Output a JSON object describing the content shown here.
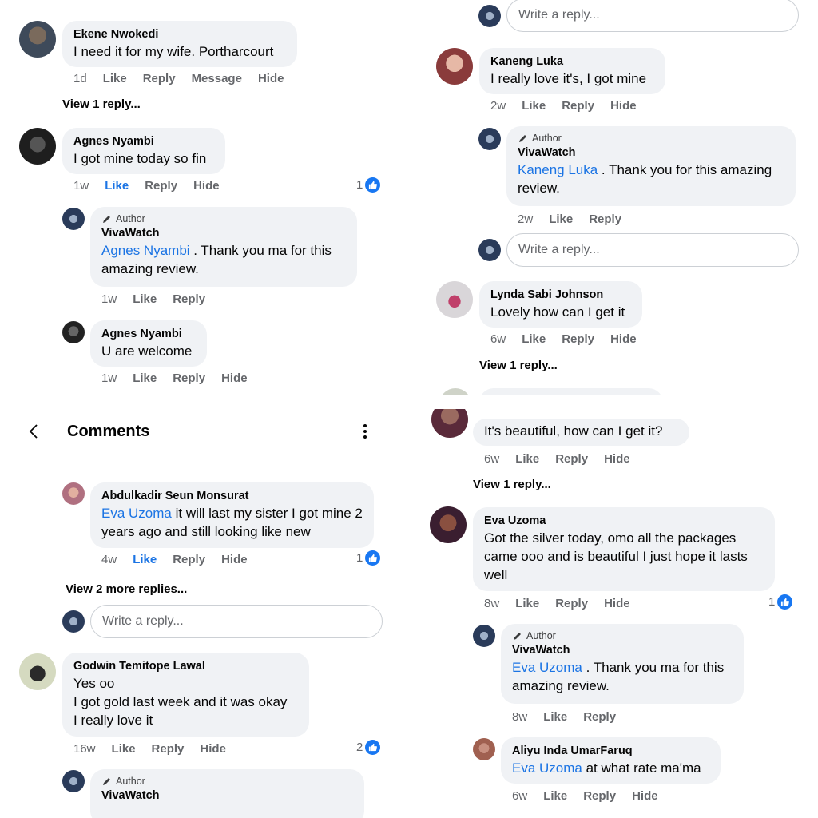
{
  "common": {
    "like": "Like",
    "reply": "Reply",
    "hide": "Hide",
    "message": "Message",
    "author_badge": "Author",
    "write_reply_placeholder": "Write a reply..."
  },
  "panel1": {
    "c1": {
      "name": "Ekene Nwokedi",
      "text": "I need it for my wife. Portharcourt",
      "time": "1d",
      "view_replies": "View 1 reply..."
    },
    "c2": {
      "name": "Agnes Nyambi",
      "text": "I got mine today so fin",
      "time": "1w",
      "reactions": "1"
    },
    "r1": {
      "name": "VivaWatch",
      "mention": "Agnes Nyambi",
      "text": " . Thank you ma  for this amazing review.",
      "time": "1w"
    },
    "r2": {
      "name": "Agnes Nyambi",
      "text": "U are welcome",
      "time": "1w"
    }
  },
  "panel2": {
    "c1": {
      "name": "Kaneng Luka",
      "text": "I really love it's, I got mine",
      "time": "2w"
    },
    "r1": {
      "name": "VivaWatch",
      "mention": "Kaneng Luka",
      "text": " . Thank you for this amazing review.",
      "time": "2w"
    },
    "c2": {
      "name": "Lynda Sabi Johnson",
      "text": "Lovely how can I get it",
      "time": "6w",
      "view_replies": "View 1 reply..."
    }
  },
  "panel3": {
    "header": {
      "title": "Comments"
    },
    "r1": {
      "name": "Abdulkadir Seun Monsurat",
      "mention": "Eva Uzoma",
      "text": " it will last my sister I got mine 2 years ago and still looking like new",
      "time": "4w",
      "reactions": "1"
    },
    "view_more": "View 2 more replies...",
    "c2": {
      "name": "Godwin Temitope Lawal",
      "line1": "Yes oo",
      "line2": "I got gold last week and it was okay",
      "line3": "I really love it",
      "time": "16w",
      "reactions": "2"
    },
    "r2": {
      "name": "VivaWatch"
    }
  },
  "panel4": {
    "c0": {
      "text": "It's beautiful, how can I get  it?",
      "time": "6w",
      "view_replies": "View 1 reply..."
    },
    "c1": {
      "name": "Eva Uzoma",
      "text": "Got the silver today, omo all the packages came ooo and is beautiful I just hope it lasts well",
      "time": "8w",
      "reactions": "1"
    },
    "r1": {
      "name": "VivaWatch",
      "mention": "Eva Uzoma",
      "text": " . Thank you ma for this amazing review.",
      "time": "8w"
    },
    "r2": {
      "name": "Aliyu Inda UmarFaruq",
      "mention": "Eva Uzoma",
      "text": " at what rate ma'ma",
      "time": "6w"
    }
  },
  "colors": {
    "mention": "#1b74e4",
    "bubble": "#f0f2f5",
    "like_blue": "#1877f2",
    "meta": "#65676b"
  }
}
